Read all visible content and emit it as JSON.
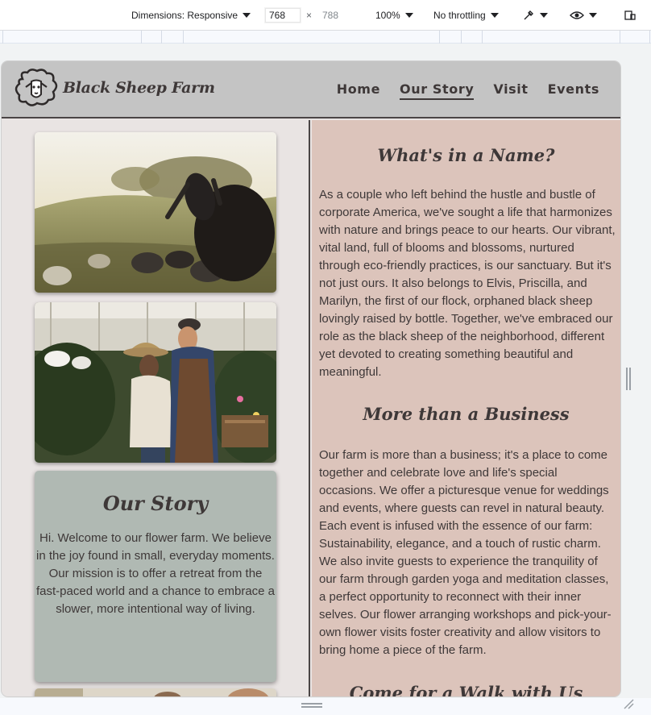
{
  "devtools": {
    "dimensions_label": "Dimensions: Responsive",
    "width_value": "768",
    "height_value": "788",
    "times": "×",
    "zoom": "100%",
    "throttling": "No throttling"
  },
  "site": {
    "brand": "Black Sheep Farm",
    "nav": [
      "Home",
      "Our Story",
      "Visit",
      "Events"
    ],
    "active_nav": "Our Story"
  },
  "story_card": {
    "title": "Our Story",
    "text": "Hi. Welcome to our flower farm. We believe in the joy found in small, everyday moments. Our mission is to offer a retreat from the fast-paced world and a chance to embrace a slower, more intentional way of living."
  },
  "sections": [
    {
      "title": "What's in a Name?",
      "text": "As a couple who left behind the hustle and bustle of corporate America, we've sought a life that harmonizes with nature and brings peace to our hearts. Our vibrant, vital land, full of blooms and blossoms, nurtured through eco-friendly practices, is our sanctuary. But it's not just ours. It also belongs to Elvis, Priscilla, and Marilyn, the first of our flock, orphaned black sheep lovingly raised by bottle. Together, we've embraced our role as the black sheep of the neighborhood, different yet devoted to creating something beautiful and meaningful."
    },
    {
      "title": "More than a Business",
      "text": "Our farm is more than a business; it's a place to come together and celebrate love and life's special occasions. We offer a picturesque venue for weddings and events, where guests can revel in natural beauty. Each event is infused with the essence of our farm: Sustainability, elegance, and a touch of rustic charm. We also invite guests to experience the tranquility of our farm through garden yoga and meditation classes, a perfect opportunity to reconnect with their inner selves. Our flower arranging workshops and pick-your-own flower visits foster creativity and allow visitors to bring home a piece of the farm."
    },
    {
      "title": "Come for a Walk with Us"
    }
  ]
}
